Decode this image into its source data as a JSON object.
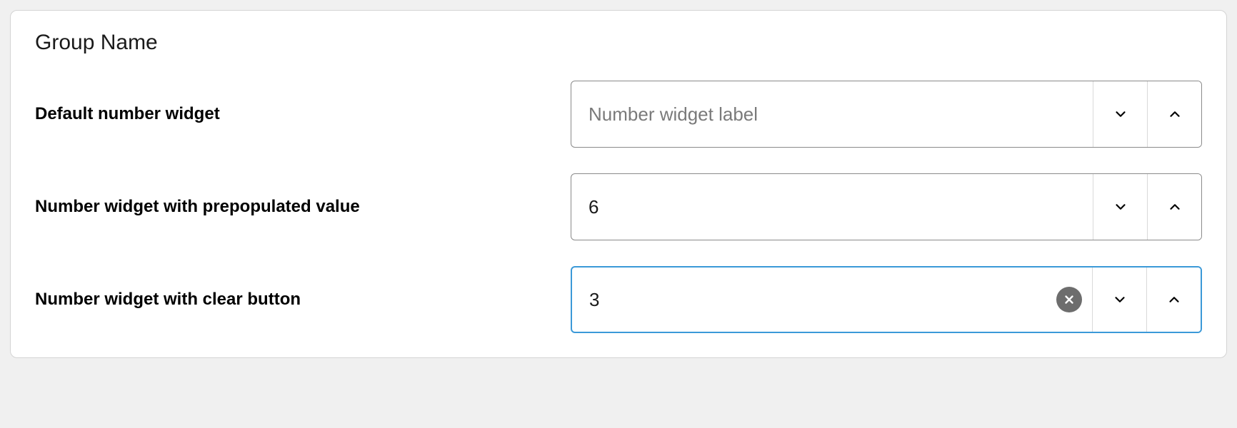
{
  "group": {
    "title": "Group Name"
  },
  "rows": {
    "default": {
      "label": "Default number widget",
      "placeholder": "Number widget label",
      "value": ""
    },
    "prepopulated": {
      "label": "Number widget with prepopulated value",
      "placeholder": "",
      "value": "6"
    },
    "clearable": {
      "label": "Number widget with clear button",
      "placeholder": "",
      "value": "3"
    }
  },
  "icons": {
    "chevron_down": "chevron-down",
    "chevron_up": "chevron-up",
    "clear": "clear-x"
  }
}
